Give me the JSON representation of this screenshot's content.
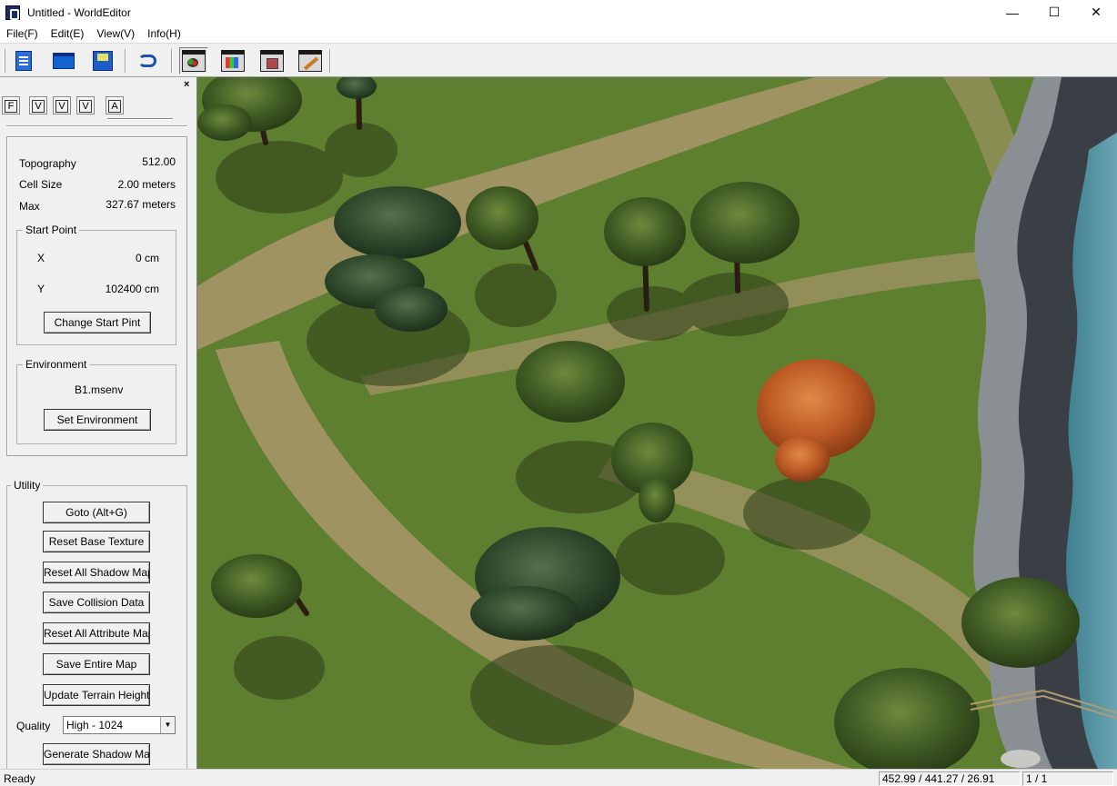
{
  "window": {
    "title": "Untitled - WorldEditor",
    "minimize": "—",
    "maximize": "☐",
    "close": "✕"
  },
  "menu": {
    "file": "File(F)",
    "edit": "Edit(E)",
    "view": "View(V)",
    "info": "Info(H)"
  },
  "toolbar": {
    "icons": [
      "new-document-icon",
      "open-folder-icon",
      "save-disk-icon",
      "undo-icon",
      "map-window-icon",
      "texture-window-icon",
      "object-window-icon",
      "brush-window-icon"
    ]
  },
  "panel": {
    "close": "×",
    "tabs": [
      "F",
      "V",
      "V",
      "V",
      "A"
    ],
    "topography_label": "Topography",
    "topography_value": "512.00",
    "cell_size_label": "Cell Size",
    "cell_size_value": "2.00 meters",
    "max_label": "Max",
    "max_value": "327.67 meters",
    "start_point": {
      "title": "Start Point",
      "x_label": "X",
      "x_value": "0 cm",
      "y_label": "Y",
      "y_value": "102400 cm",
      "button": "Change Start Pint"
    },
    "environment": {
      "title": "Environment",
      "file": "B1.msenv",
      "button": "Set Environment"
    },
    "utility": {
      "title": "Utility",
      "goto": "Goto (Alt+G)",
      "reset_base_texture": "Reset Base Texture",
      "reset_all_shadow_map": "Reset All Shadow Map",
      "save_collision_data": "Save Collision Data",
      "reset_all_attribute_map": "Reset All Attribute Map",
      "save_entire_map": "Save Entire Map",
      "update_terrain_height": "Update Terrain Height",
      "quality_label": "Quality",
      "quality_value": "High - 1024",
      "generate_shadow_map": "Generate Shadow Map"
    }
  },
  "status": {
    "text": "Ready",
    "coords": "452.99 / 441.27 / 26.91",
    "page": "1 / 1"
  },
  "colors": {
    "grass": "#5a7a2e",
    "path": "#a89868",
    "water": "#4e8c9a",
    "rock": "#8a8f94",
    "autumn_tree": "#c8642a"
  }
}
